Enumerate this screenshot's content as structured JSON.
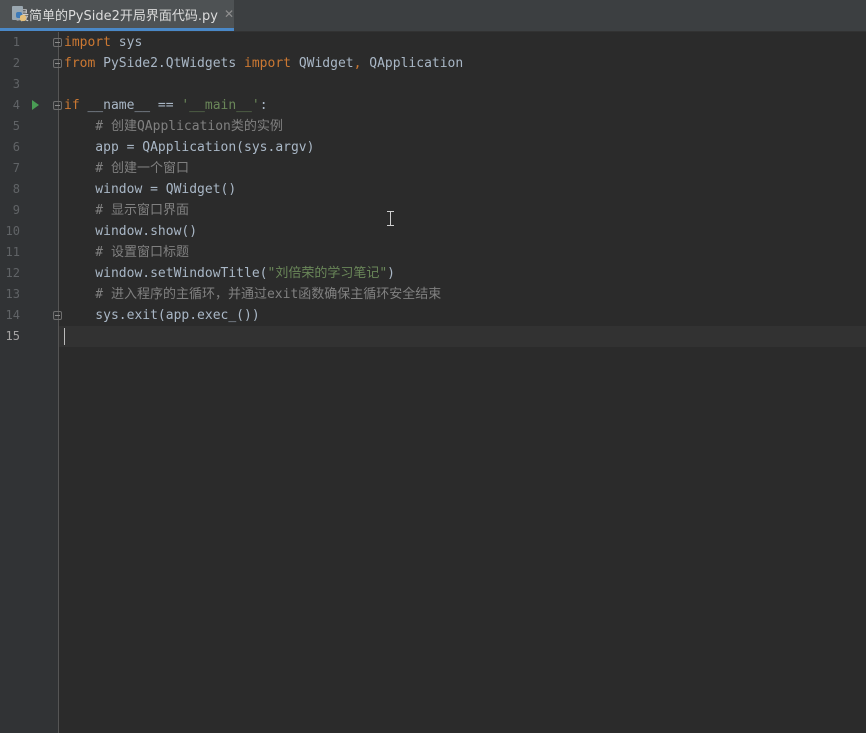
{
  "tab": {
    "filename": "最简单的PySide2开局界面代码.py",
    "close_symbol": "✕",
    "icon": "python-file-icon"
  },
  "gutter": {
    "line_numbers": [
      "1",
      "2",
      "3",
      "4",
      "5",
      "6",
      "7",
      "8",
      "9",
      "10",
      "11",
      "12",
      "13",
      "14",
      "15"
    ],
    "run_marker_line": "4"
  },
  "code": {
    "l1_kw": "import",
    "l1_rest": " sys",
    "l2_kw1": "from",
    "l2_mod": " PySide2.QtWidgets ",
    "l2_kw2": "import",
    "l2_rest1": " QWidget",
    "l2_comma": ",",
    "l2_rest2": " QApplication",
    "l4_kw": "if",
    "l4_rest": " __name__ == ",
    "l4_str": "'__main__'",
    "l4_colon": ":",
    "l5": "    # 创建QApplication类的实例",
    "l6": "    app = QApplication(sys.argv)",
    "l7": "    # 创建一个窗口",
    "l8": "    window = QWidget()",
    "l9": "    # 显示窗口界面",
    "l10": "    window.show()",
    "l11": "    # 设置窗口标题",
    "l12_pre": "    window.setWindowTitle(",
    "l12_str": "\"刘倍荣的学习笔记\"",
    "l12_post": ")",
    "l13": "    # 进入程序的主循环，并通过exit函数确保主循环安全结束",
    "l14": "    sys.exit(app.exec_())"
  },
  "colors": {
    "background": "#2b2b2b",
    "keyword": "#cc7832",
    "string": "#6a8759",
    "comment": "#808080",
    "text": "#a9b7c6",
    "tab_underline": "#4a88c7"
  }
}
